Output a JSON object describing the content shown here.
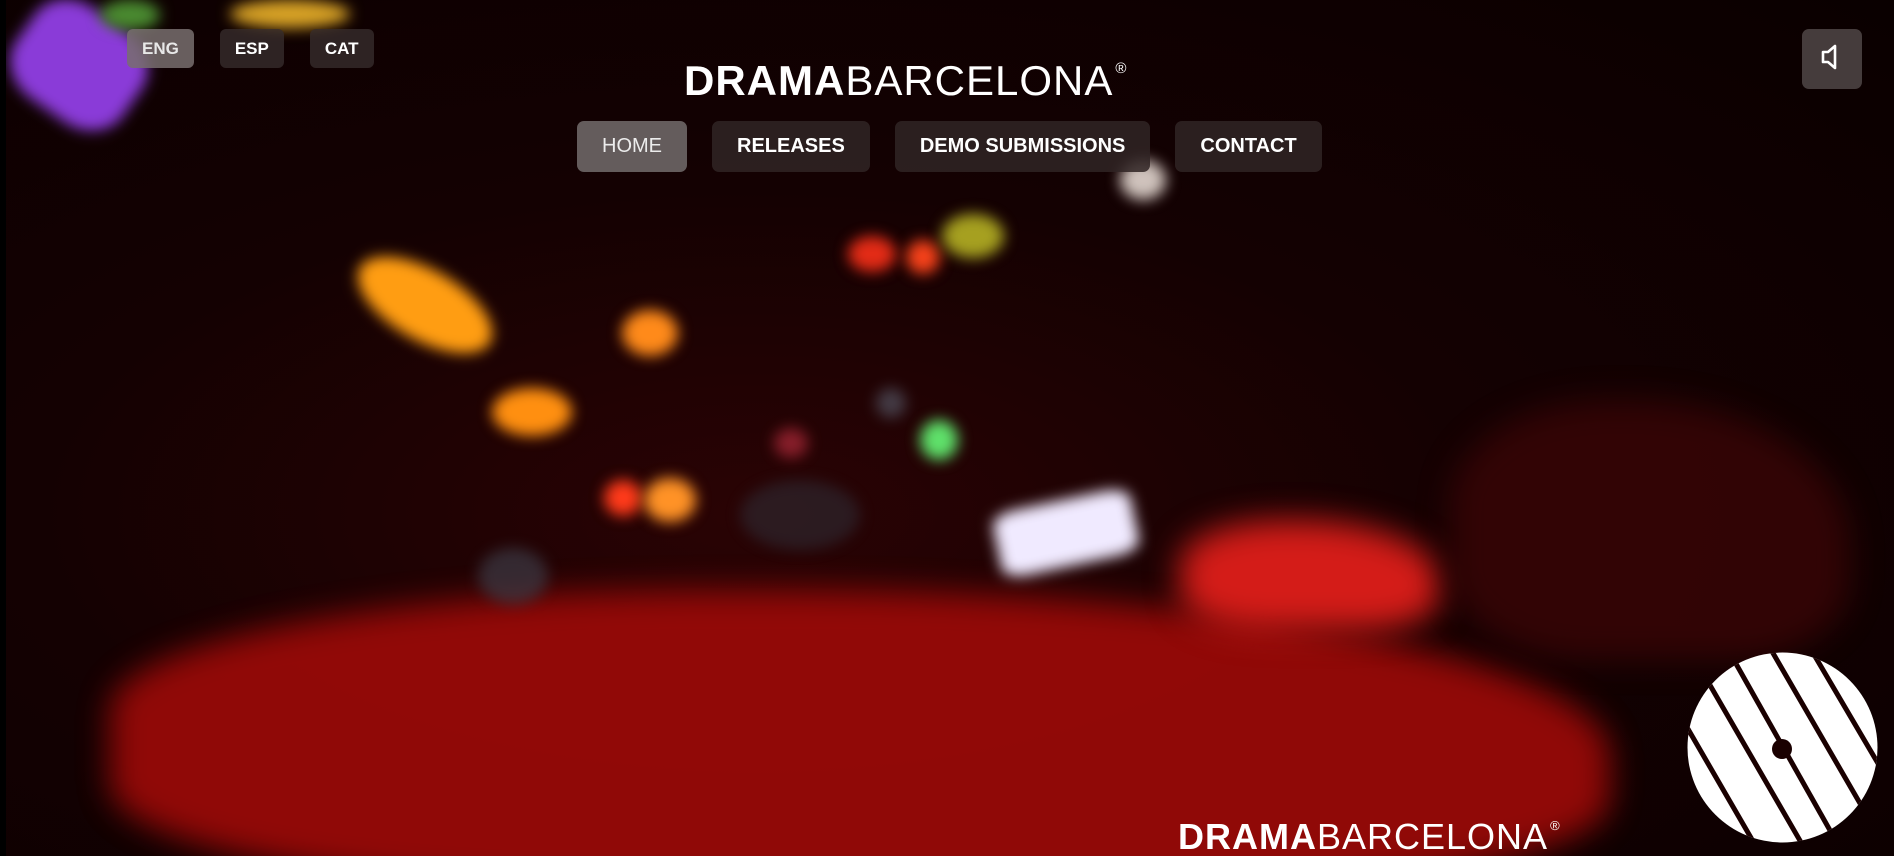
{
  "languages": {
    "items": [
      "ENG",
      "ESP",
      "CAT"
    ],
    "active": "ENG"
  },
  "brand": {
    "name_bold": "DRAMA",
    "name_light": "BARCELONA",
    "registered_mark": "®"
  },
  "nav": {
    "items": [
      "HOME",
      "RELEASES",
      "DEMO SUBMISSIONS",
      "CONTACT"
    ],
    "active": "HOME"
  },
  "sound": {
    "icon": "speaker-muted-icon"
  },
  "footer_brand": {
    "name_bold": "DRAMA",
    "name_light": "BARCELONA",
    "registered_mark": "®"
  },
  "colors": {
    "background": "#0a0000",
    "accent_red": "#c4120e",
    "button_bg": "#302424",
    "button_active_bg": "#6e6666",
    "text": "#ffffff"
  }
}
